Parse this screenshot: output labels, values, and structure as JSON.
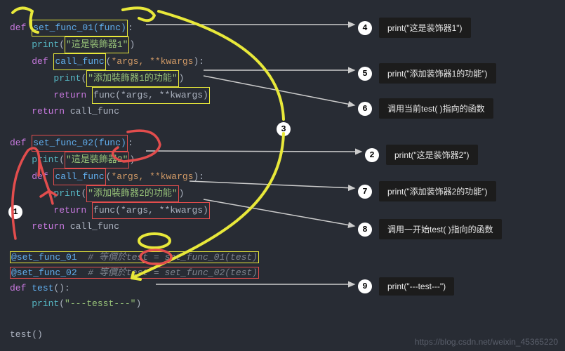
{
  "code": {
    "l1": {
      "a": "def ",
      "b": "set_func_01(func)",
      "c": ":"
    },
    "l2": {
      "a": "    ",
      "b": "print",
      "c": "(",
      "d": "\"這是裝飾器1\"",
      "e": ")"
    },
    "l3": {
      "a": "    ",
      "b": "def ",
      "c": "call_func",
      "d": "(",
      "e": "*args, **kwargs",
      "f": "):"
    },
    "l4": {
      "a": "        ",
      "b": "print",
      "c": "(",
      "d": "\"添加裝飾器1的功能\"",
      "e": ")"
    },
    "l5": {
      "a": "        ",
      "b": "return ",
      "c": "func(*args, **kwargs)"
    },
    "l6": {
      "a": "    ",
      "b": "return ",
      "c": "call_func"
    },
    "l7": {
      "a": "def ",
      "b": "set_func_02(func)",
      "c": ":"
    },
    "l8": {
      "a": "    ",
      "b": "print",
      "c": "(",
      "d": "\"這是裝飾器2\"",
      "e": ")"
    },
    "l9": {
      "a": "    ",
      "b": "def ",
      "c": "call_func",
      "d": "(",
      "e": "*args, **kwargs",
      "f": "):"
    },
    "l10": {
      "a": "        ",
      "b": "print",
      "c": "(",
      "d": "\"添加裝飾器2的功能\"",
      "e": ")"
    },
    "l11": {
      "a": "        ",
      "b": "return ",
      "c": "func(*args, **kwargs)"
    },
    "l12": {
      "a": "    ",
      "b": "return ",
      "c": "call_func"
    },
    "l13": {
      "a": "@set_func_01",
      "b": "  # 等價於test = set_func_01(test)"
    },
    "l14": {
      "a": "@set_func_02",
      "b": "  # 等價於test = set_func_02(test)"
    },
    "l15": {
      "a": "def ",
      "b": "test",
      "c": "():"
    },
    "l16": {
      "a": "    ",
      "b": "print",
      "c": "(",
      "d": "\"---tesst---\"",
      "e": ")"
    },
    "l17": {
      "a": "test()"
    }
  },
  "steps": {
    "s1": {
      "n": "1"
    },
    "s2": {
      "n": "2",
      "t": "print(\"这是装饰器2\")"
    },
    "s3": {
      "n": "3"
    },
    "s4": {
      "n": "4",
      "t": "print(\"这是装饰器1\")"
    },
    "s5": {
      "n": "5",
      "t": "print(\"添加装饰器1的功能\")"
    },
    "s6": {
      "n": "6",
      "t": "调用当前test( )指向的函数"
    },
    "s7": {
      "n": "7",
      "t": "print(\"添加装饰器2的功能\")"
    },
    "s8": {
      "n": "8",
      "t": "调用一开始test( )指向的函数"
    },
    "s9": {
      "n": "9",
      "t": "print(\"---test---\")"
    }
  },
  "watermark": "https://blog.csdn.net/weixin_45365220"
}
